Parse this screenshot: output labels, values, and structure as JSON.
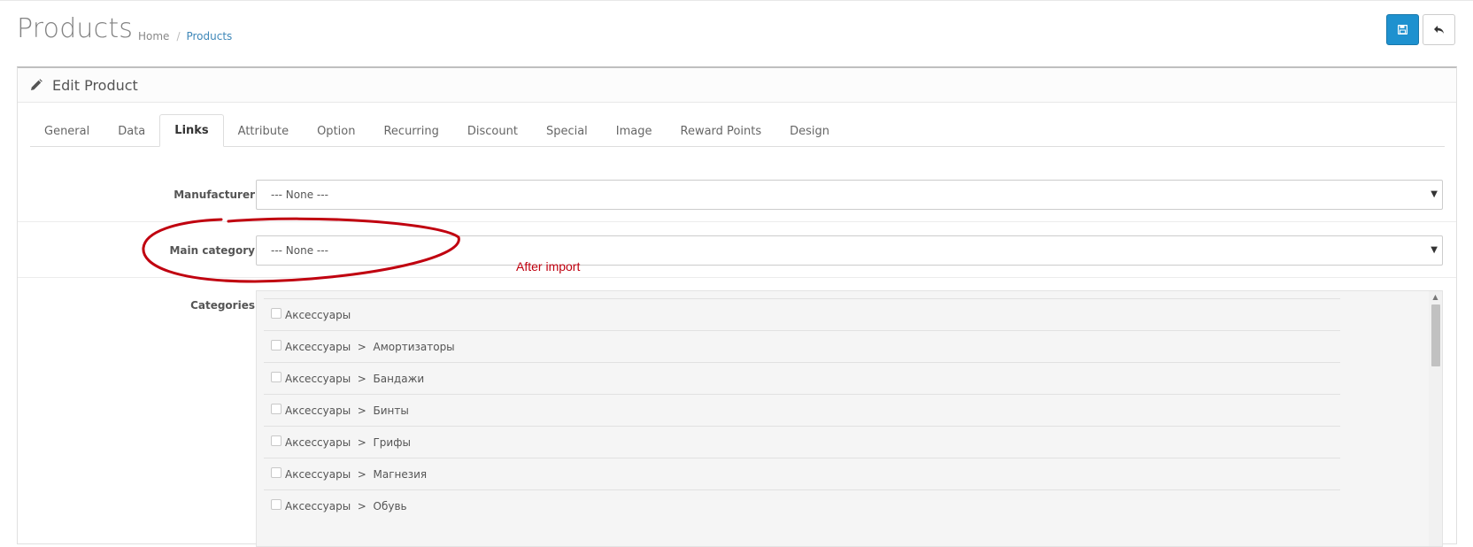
{
  "header": {
    "title": "Products",
    "breadcrumb": [
      {
        "label": "Home"
      },
      {
        "label": "Products"
      }
    ],
    "buttons": {
      "save_icon": "save-icon",
      "back_icon": "reply-icon"
    }
  },
  "panel": {
    "heading": "Edit Product",
    "heading_icon": "pencil-icon"
  },
  "tabs": [
    {
      "label": "General"
    },
    {
      "label": "Data"
    },
    {
      "label": "Links",
      "active": true
    },
    {
      "label": "Attribute"
    },
    {
      "label": "Option"
    },
    {
      "label": "Recurring"
    },
    {
      "label": "Discount"
    },
    {
      "label": "Special"
    },
    {
      "label": "Image"
    },
    {
      "label": "Reward Points"
    },
    {
      "label": "Design"
    }
  ],
  "form": {
    "manufacturer": {
      "label": "Manufacturer",
      "value": "--- None ---"
    },
    "main_category": {
      "label": "Main category",
      "value": "--- None ---"
    },
    "categories": {
      "label": "Categories",
      "items": [
        "Аксессуары",
        "Аксессуары  >  Амортизаторы",
        "Аксессуары  >  Бандажи",
        "Аксессуары  >  Бинты",
        "Аксессуары  >  Грифы",
        "Аксессуары  >  Магнезия",
        "Аксессуары  >  Обувь"
      ]
    }
  },
  "annotation": {
    "text": "After import",
    "color": "#c0000f"
  },
  "colors": {
    "primary": "#1e91cf",
    "link": "#3e87b8"
  }
}
